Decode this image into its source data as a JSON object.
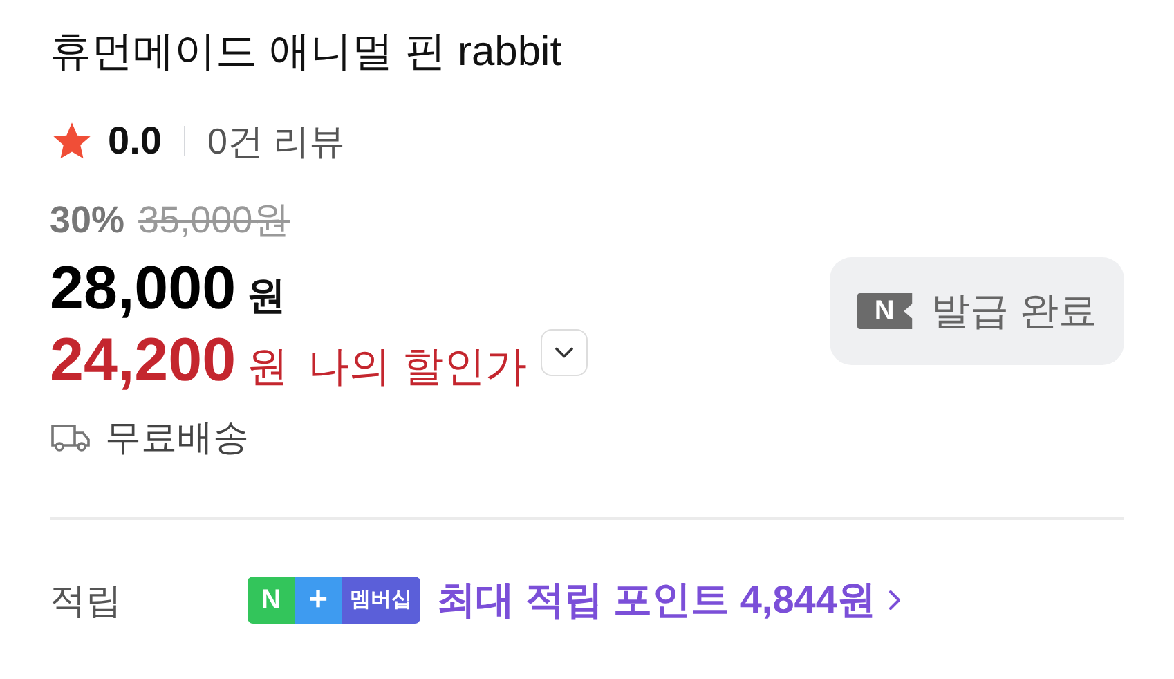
{
  "product": {
    "title": "휴먼메이드 애니멀 핀 rabbit"
  },
  "rating": {
    "score": "0.0",
    "reviews": "0건 리뷰"
  },
  "price": {
    "discount_rate": "30%",
    "original": "35,000원",
    "sale_amount": "28,000",
    "sale_unit": "원",
    "my_amount": "24,200",
    "my_unit": "원",
    "my_label": "나의 할인가"
  },
  "coupon": {
    "mark": "N",
    "label": "발급 완료"
  },
  "shipping": {
    "label": "무료배송"
  },
  "points": {
    "label": "적립",
    "badge_n": "N",
    "badge_plus": "+",
    "badge_text": "멤버십",
    "text": "최대 적립 포인트 4,844원"
  }
}
